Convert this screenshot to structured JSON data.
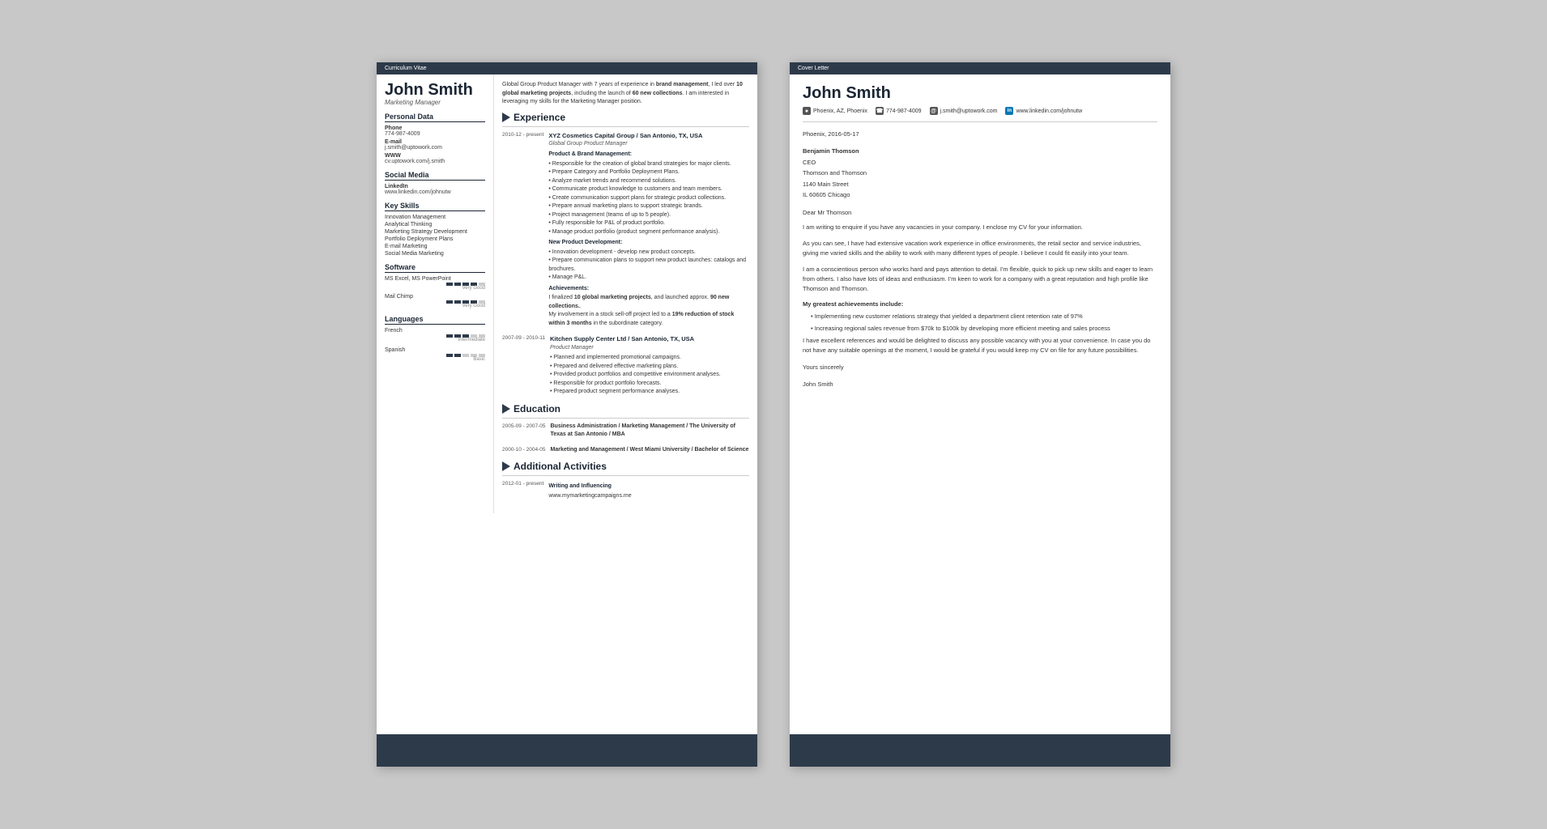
{
  "cv": {
    "header_label": "Curriculum Vitae",
    "name": "John Smith",
    "title": "Marketing Manager",
    "summary": "Global Group Product Manager with 7 years of experience in brand management, I led over 10 global marketing projects, including the launch of 60 new collections. I am interested in leveraging my skills for the Marketing Manager position.",
    "sidebar": {
      "personal_data_label": "Personal Data",
      "phone_label": "Phone",
      "phone_value": "774-987-4009",
      "email_label": "E-mail",
      "email_value": "j.smith@uptowork.com",
      "www_label": "WWW",
      "www_value": "cv.uptowork.com/j.smith",
      "social_media_label": "Social Media",
      "linkedin_label": "LinkedIn",
      "linkedin_value": "www.linkedin.com/johnutw",
      "skills_label": "Key Skills",
      "skills": [
        "Innovation Management",
        "Analytical Thinking",
        "Marketing Strategy Development",
        "Portfolio Deployment Plans",
        "E-mail Marketing",
        "Social Media Marketing"
      ],
      "software_label": "Software",
      "software": [
        {
          "name": "MS Excel, MS PowerPoint",
          "filled": 4,
          "total": 5,
          "level": "Very Good"
        },
        {
          "name": "Mail Chimp",
          "filled": 4,
          "total": 5,
          "level": "Very Good"
        }
      ],
      "languages_label": "Languages",
      "languages": [
        {
          "name": "French",
          "filled": 3,
          "total": 5,
          "level": "Intermediate"
        },
        {
          "name": "Spanish",
          "filled": 2,
          "total": 5,
          "level": "Basic"
        }
      ]
    },
    "experience_label": "Experience",
    "experience": [
      {
        "date": "2010-12 - present",
        "company": "XYZ Cosmetics Capital Group / San Antonio, TX, USA",
        "role": "Global Group Product Manager",
        "subsections": [
          {
            "title": "Product & Brand Management:",
            "bullets": [
              "Responsible for the creation of global brand strategies for major clients.",
              "Prepare Category and Portfolio Deployment Plans.",
              "Analyze market trends and recommend solutions.",
              "Communicate product knowledge to customers and team members.",
              "Create communication support plans for strategic product collections.",
              "Prepare annual marketing plans to support strategic brands.",
              "Project management (teams of up to 5 people).",
              "Fully responsible for P&L of product portfolio.",
              "Manage product portfolio (product segment performance analysis)."
            ]
          },
          {
            "title": "New Product Development:",
            "bullets": [
              "Innovation development - develop new product concepts.",
              "Prepare communication plans to support new product launches: catalogs and brochures.",
              "Manage P&L."
            ]
          },
          {
            "title": "Achievements:",
            "achievement": "I finalized 10 global marketing projects, and launched approx. 90 new collections.\nMy involvement in a stock sell-off project led to a 19% reduction of stock within 3 months in the subordinate category."
          }
        ]
      },
      {
        "date": "2007-09 - 2010-11",
        "company": "Kitchen Supply Center Ltd / San Antonio, TX, USA",
        "role": "Product Manager",
        "bullets": [
          "Planned and implemented promotional campaigns.",
          "Prepared and delivered effective marketing plans.",
          "Provided product portfolios and competitive environment analyses.",
          "Responsible for product portfolio forecasts.",
          "Prepared product segment performance analyses."
        ]
      }
    ],
    "education_label": "Education",
    "education": [
      {
        "date": "2005-09 - 2007-05",
        "degree": "Business Administration / Marketing Management / The University of Texas at San Antonio / MBA"
      },
      {
        "date": "2000-10 - 2004-05",
        "degree": "Marketing and Management / West Miami University / Bachelor of Science"
      }
    ],
    "activities_label": "Additional Activities",
    "activities": [
      {
        "date": "2012-01 - present",
        "title": "Writing and Influencing",
        "detail": "www.mymarketingcampaigns.me"
      }
    ]
  },
  "cl": {
    "header_label": "Cover Letter",
    "name": "John Smith",
    "contact": {
      "location": "Phoenix, AZ, Phoenix",
      "phone": "774-987-4009",
      "email": "j.smith@uptowork.com",
      "linkedin": "www.linkedin.com/johnutw"
    },
    "date": "Phoenix, 2016-05-17",
    "recipient": {
      "name": "Benjamin Thomson",
      "title": "CEO",
      "company": "Thomson and Thomson",
      "address": "1140 Main Street",
      "city": "IL 60605 Chicago"
    },
    "salutation": "Dear Mr Thomson",
    "paragraphs": [
      "I am writing to enquire if you have any vacancies in your company. I enclose my CV for your information.",
      "As you can see, I have had extensive vacation work experience in office environments, the retail sector and service industries, giving me varied skills and the ability to work with many different types of people. I believe I could fit easily into your team.",
      "I am a conscientious person who works hard and pays attention to detail. I'm flexible, quick to pick up new skills and eager to learn from others. I also have lots of ideas and enthusiasm. I'm keen to work for a company with a great reputation and high profile like Thomson and Thomson."
    ],
    "achievements_title": "My greatest achievements include:",
    "achievements": [
      "Implementing new customer relations strategy that yielded a department client retention rate of 97%",
      "Increasing regional sales revenue from $70k to $100k by developing more efficient meeting and sales process"
    ],
    "closing_paragraph": "I have excellent references and would be delighted to discuss any possible vacancy with you at your convenience. In case you do not have any suitable openings at the moment, I would be grateful if you would keep my CV on file for any future possibilities.",
    "valediction": "Yours sincerely",
    "sign_name": "John Smith"
  }
}
